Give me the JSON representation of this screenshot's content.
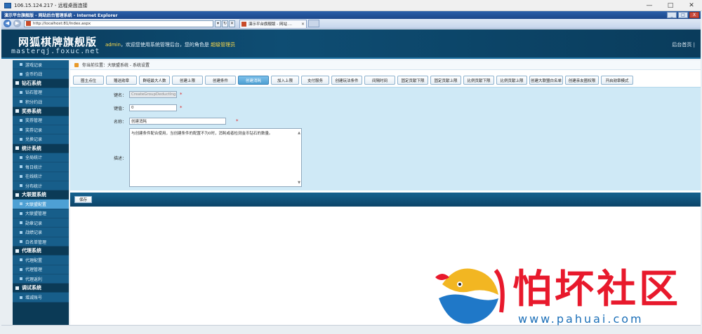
{
  "rdp": {
    "title": "106.15.124.217 - 远程桌面连接"
  },
  "window_buttons": {
    "minimize": "—",
    "maximize": "□",
    "close": "✕"
  },
  "ie": {
    "title": "演示平台旗舰版 - 网站后台管理系统 - Internet Explorer",
    "address": "http://localhost:81/Index.aspx",
    "tab_label": "演示平台旗舰版 - 网站 ...",
    "tab_close": "×",
    "back": "◀",
    "forward": "▶",
    "addr_dropdown": "▾",
    "addr_refresh": "↻",
    "addr_stop": "✕",
    "title_min": "_",
    "title_max": "□",
    "title_close": "X"
  },
  "header": {
    "logo_title": "网狐棋牌旗舰版",
    "logo_sub": "masterqj.foxuc.net",
    "welcome_user": "admin",
    "welcome_text": "，欢迎您使用系统管理后台，您的角色是",
    "welcome_role": "超级管理员",
    "right_link": "后台首页 |"
  },
  "sidebar": [
    {
      "type": "item",
      "label": "游戏记录"
    },
    {
      "type": "item",
      "label": "金币约战"
    },
    {
      "type": "group",
      "label": "钻石系统"
    },
    {
      "type": "item",
      "label": "钻石管理"
    },
    {
      "type": "item",
      "label": "积分约战"
    },
    {
      "type": "group",
      "label": "奖券系统"
    },
    {
      "type": "item",
      "label": "奖券管理"
    },
    {
      "type": "item",
      "label": "奖券记录"
    },
    {
      "type": "item",
      "label": "兑换记录"
    },
    {
      "type": "group",
      "label": "统计系统"
    },
    {
      "type": "item",
      "label": "全局统计"
    },
    {
      "type": "item",
      "label": "每日统计"
    },
    {
      "type": "item",
      "label": "在线统计"
    },
    {
      "type": "item",
      "label": "分布统计"
    },
    {
      "type": "group",
      "label": "大联盟系统"
    },
    {
      "type": "item",
      "label": "大联盟配置",
      "active": true
    },
    {
      "type": "item",
      "label": "大联盟管理"
    },
    {
      "type": "item",
      "label": "勋章记录"
    },
    {
      "type": "item",
      "label": "战绩记录"
    },
    {
      "type": "item",
      "label": "白名单管理"
    },
    {
      "type": "group",
      "label": "代理系统"
    },
    {
      "type": "item",
      "label": "代理配置"
    },
    {
      "type": "item",
      "label": "代理管理"
    },
    {
      "type": "item",
      "label": "代理返利"
    },
    {
      "type": "group",
      "label": "调试系统"
    },
    {
      "type": "item",
      "label": "增减账号"
    }
  ],
  "breadcrumb": "你当前位置：大联盟系统 - 系统设置",
  "config_tabs": [
    {
      "label": "圈主点位"
    },
    {
      "label": "赠送勋章"
    },
    {
      "label": "群组最大人数"
    },
    {
      "label": "创建上限"
    },
    {
      "label": "创建条件"
    },
    {
      "label": "创建消耗",
      "active": true
    },
    {
      "label": "加入上限"
    },
    {
      "label": "支付服务"
    },
    {
      "label": "创建玩法条件"
    },
    {
      "label": "间隔时间"
    },
    {
      "label": "固定贡献下限"
    },
    {
      "label": "固定贡献上限"
    },
    {
      "label": "比例贡献下限"
    },
    {
      "label": "比例贡献上限"
    },
    {
      "label": "创建大联盟白名单"
    },
    {
      "label": "创建亲友圈权限"
    },
    {
      "label": "开启勋章模式"
    }
  ],
  "form": {
    "key_label": "键名：",
    "key_value": "CreateGroupDeductIng",
    "value_label": "键值：",
    "value_value": "0",
    "name_label": "名称：",
    "name_value": "创建消耗",
    "desc_label": "描述：",
    "desc_value": "与创建条件配合使用，当创建条件的配置不为0时，消耗或者检测金币钻石的数量。",
    "required_mark": "*",
    "scroll_up": "▲",
    "scroll_down": "▼"
  },
  "save_label": "保存",
  "watermark": {
    "text": "怕坏社区",
    "url": "www.pahuai.com"
  },
  "colors": {
    "header_bg": "#0e4d73",
    "sidebar_bg": "#0b3a56",
    "active_tab": "#4d9fd3",
    "form_bg": "#cfe9f6",
    "role_highlight": "#ffdc4a"
  }
}
